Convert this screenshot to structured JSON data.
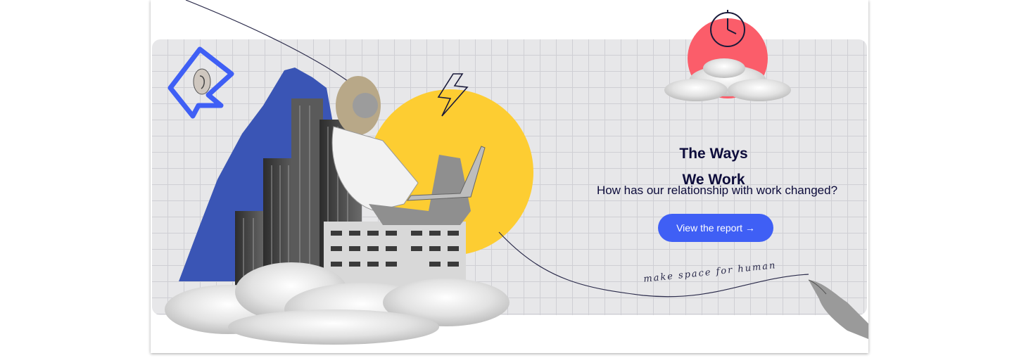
{
  "banner": {
    "title_line1": "The Ways",
    "title_line2": "We Work",
    "subtitle": "How has our relationship with work changed?",
    "cta_label": "View the report →",
    "script_text": "make space for human"
  },
  "colors": {
    "accent": "#3f5ff5",
    "yellow": "#fdcd32",
    "coral": "#fb5d6a",
    "navy": "#0d0c3b",
    "collage_blue": "#3a55b5"
  },
  "icons": [
    "ear-speech-bubble-icon",
    "lightning-icon",
    "clock-icon",
    "pointing-hand-icon"
  ]
}
